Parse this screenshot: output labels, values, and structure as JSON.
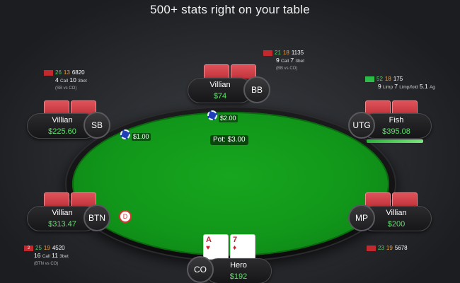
{
  "headline": "500+ stats right on your table",
  "pot": "Pot: $3.00",
  "bets": {
    "bb_bet": "$2.00",
    "sb_bet": "$1.00"
  },
  "dealer_button": "D",
  "seats": {
    "bb": {
      "name": "Villian",
      "stack": "$74",
      "position": "BB"
    },
    "sb": {
      "name": "Villian",
      "stack": "$225.60",
      "position": "SB"
    },
    "utg": {
      "name": "Fish",
      "stack": "$395.08",
      "position": "UTG"
    },
    "btn": {
      "name": "Villian",
      "stack": "$313.47",
      "position": "BTN"
    },
    "mp": {
      "name": "Villian",
      "stack": "$200",
      "position": "MP"
    },
    "hero": {
      "name": "Hero",
      "stack": "$192",
      "position": "CO"
    }
  },
  "hero_cards": [
    {
      "rank": "A",
      "suit": "♥"
    },
    {
      "rank": "7",
      "suit": "♦"
    }
  ],
  "hud": {
    "bb": {
      "s1": "21",
      "s2": "18",
      "s3": "1135",
      "l2a": "9",
      "l2a_lbl": "Call",
      "l2b": "7",
      "l2b_lbl": "3bet",
      "note": "(BB vs CO)"
    },
    "sb": {
      "s1": "26",
      "s2": "13",
      "s3": "6820",
      "l2a": "4",
      "l2a_lbl": "Call",
      "l2b": "10",
      "l2b_lbl": "3bet",
      "note": "(SB vs CO)"
    },
    "utg": {
      "s1": "52",
      "s2": "18",
      "s3": "175",
      "l2a": "9",
      "l2a_lbl": "Limp",
      "l2b": "7",
      "l2b_lbl": "Limp/fold",
      "l2c": "5.1",
      "l2c_lbl": "Ag"
    },
    "btn": {
      "flag": "2",
      "s1": "25",
      "s2": "19",
      "s3": "4520",
      "l2a": "16",
      "l2a_lbl": "Call",
      "l2b": "11",
      "l2b_lbl": "3bet",
      "note": "(BTN vs CO)"
    },
    "mp": {
      "s1": "23",
      "s2": "19",
      "s3": "5678"
    }
  },
  "colors": {
    "felt": "#11971a",
    "card_back": "#d0454c",
    "stack_green": "#5ee36a",
    "hud_red": "#e74b4b",
    "hud_orange": "#f39c3a",
    "hud_green": "#48d65e"
  }
}
